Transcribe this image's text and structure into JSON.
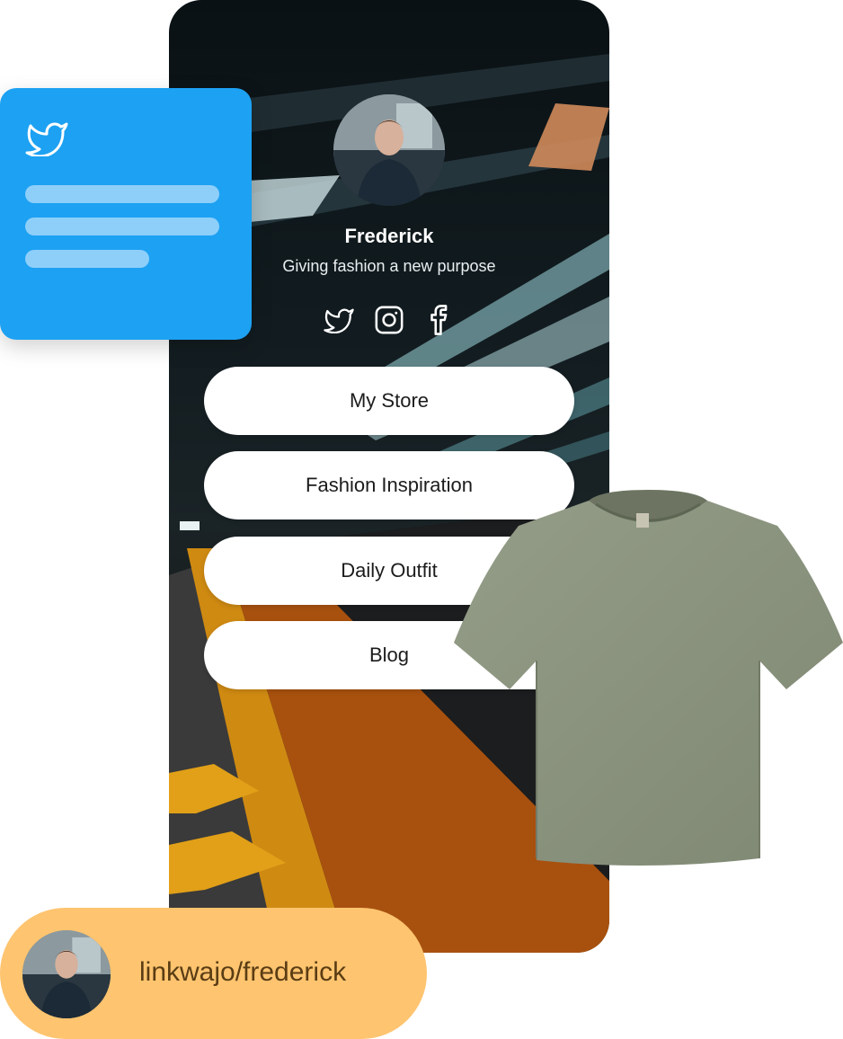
{
  "profile": {
    "name": "Frederick",
    "bio": "Giving fashion a new purpose"
  },
  "socials": [
    {
      "icon": "twitter-icon"
    },
    {
      "icon": "instagram-icon"
    },
    {
      "icon": "facebook-icon"
    }
  ],
  "links": [
    {
      "label": "My Store"
    },
    {
      "label": "Fashion Inspiration"
    },
    {
      "label": "Daily Outfit"
    },
    {
      "label": "Blog"
    }
  ],
  "twitter_card": {
    "icon": "twitter-icon",
    "color": "#1da1f2"
  },
  "url_pill": {
    "text": "linkwajo/frederick",
    "color": "#fec46f"
  },
  "product": {
    "icon": "tshirt-icon",
    "color": "#8b9580"
  }
}
